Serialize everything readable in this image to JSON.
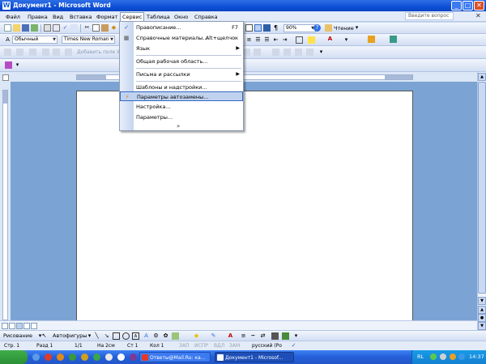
{
  "window": {
    "title": "Документ1 - Microsoft Word",
    "minimize": "_",
    "maximize": "□",
    "close": "✕",
    "icon": "word-icon"
  },
  "menu": {
    "items": [
      "Файл",
      "Правка",
      "Вид",
      "Вставка",
      "Формат",
      "Сервис",
      "Таблица",
      "Окно",
      "Справка"
    ],
    "active": "Сервис",
    "help_placeholder": "Введите вопрос",
    "doc_close": "✕"
  },
  "toolbar": {
    "style_value": "Обычный",
    "font_value": "Times New Roman",
    "zoom_value": "90%",
    "reading_label": "Чтение",
    "add_field_label": "Добавить поле W..."
  },
  "tools_menu": {
    "items": [
      {
        "label": "Правописание...",
        "shortcut": "F7",
        "icon": "spelling-icon"
      },
      {
        "label": "Справочные материалы...",
        "shortcut": "Alt+щелчок",
        "icon": "research-icon"
      },
      {
        "label": "Язык",
        "submenu": true
      },
      {
        "label": "Общая рабочая область..."
      },
      {
        "label": "Письма и рассылки",
        "submenu": true
      },
      {
        "label": "Шаблоны и надстройки..."
      },
      {
        "label": "Параметры автозамены...",
        "highlighted": true,
        "icon": "autocorrect-icon"
      },
      {
        "label": "Настройка..."
      },
      {
        "label": "Параметры..."
      }
    ],
    "expand_icon": "chevron-double-down-icon"
  },
  "draw_toolbar": {
    "draw_label": "Рисование",
    "autoshapes_label": "Автофигуры"
  },
  "status_bar": {
    "page": "Стр. 1",
    "section": "Разд 1",
    "page_of": "1/1",
    "position": "На 2см",
    "line": "Ст 1",
    "column": "Кол 1",
    "rec": "ЗАП",
    "trk": "ИСПР",
    "ext": "ВДЛ",
    "ovr": "ЗАМ",
    "language": "русский (Ро"
  },
  "taskbar": {
    "tasks": [
      {
        "label": "Ответы@Mail.Ru: ка...",
        "active": false
      },
      {
        "label": "Документ1 - Microsof...",
        "active": true
      }
    ],
    "lang": "RL",
    "clock": "14:37"
  },
  "colors": {
    "titlebar": "#0d4fd6",
    "workspace": "#7ba4d4",
    "menu_highlight": "#c1d2ee",
    "taskbar": "#245fd8",
    "start": "#2a8f34"
  }
}
